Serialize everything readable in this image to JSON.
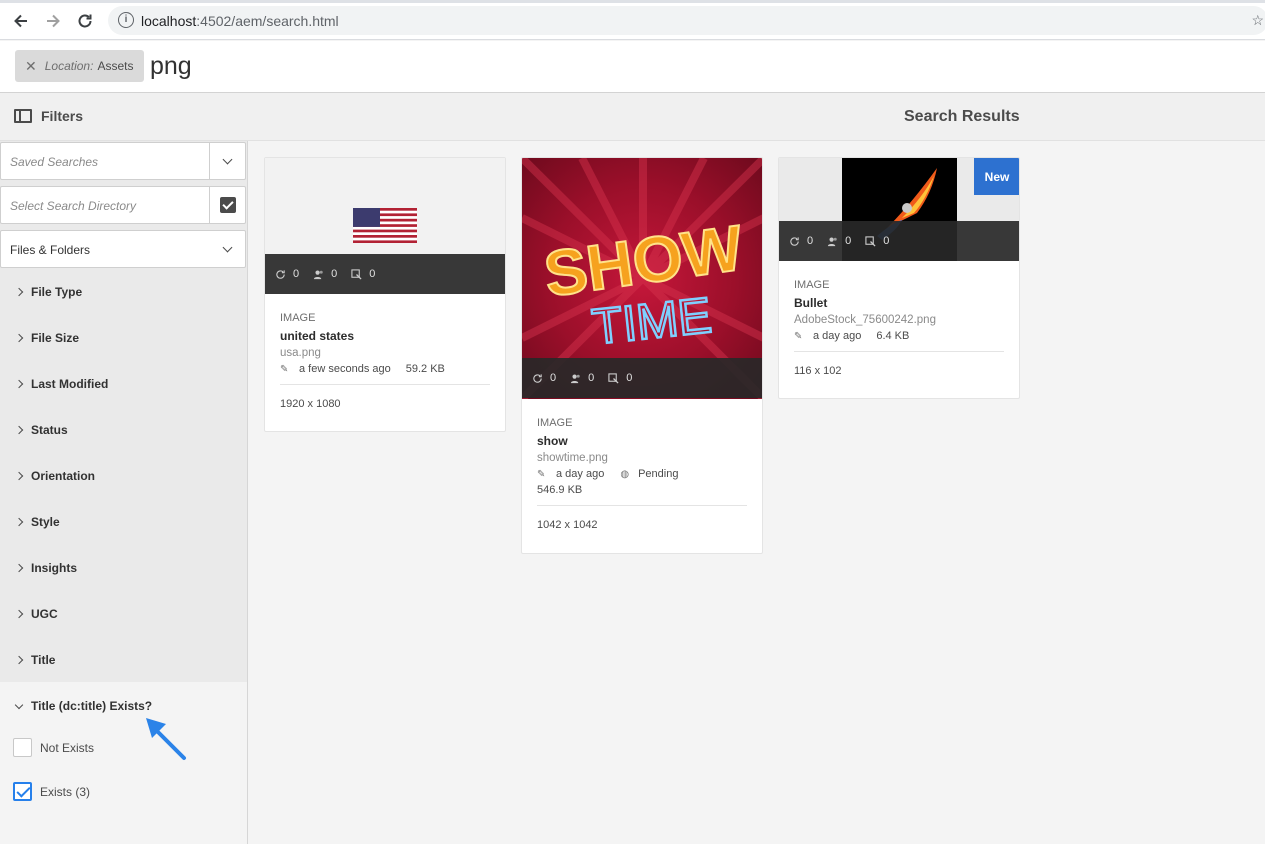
{
  "browser": {
    "url_host": "localhost",
    "url_rest": ":4502/aem/search.html"
  },
  "search": {
    "location_key": "Location:",
    "location_value": "Assets",
    "query": "png"
  },
  "header": {
    "filters_label": "Filters",
    "results_label": "Search Results"
  },
  "rail": {
    "saved_searches_placeholder": "Saved Searches",
    "directory_placeholder": "Select Search Directory",
    "scope_value": "Files & Folders",
    "facets": [
      "File Type",
      "File Size",
      "Last Modified",
      "Status",
      "Orientation",
      "Style",
      "Insights",
      "UGC",
      "Title"
    ],
    "expanded_facet": "Title (dc:title) Exists?",
    "options": [
      {
        "label": "Not Exists",
        "checked": false
      },
      {
        "label": "Exists (3)",
        "checked": true
      }
    ]
  },
  "cards": [
    {
      "type": "IMAGE",
      "title": "united states",
      "file": "usa.png",
      "modified": "a few seconds ago",
      "size": "59.2 KB",
      "dimensions": "1920 x 1080",
      "counts": [
        "0",
        "0",
        "0"
      ]
    },
    {
      "type": "IMAGE",
      "title": "show",
      "file": "showtime.png",
      "modified": "a day ago",
      "status": "Pending",
      "size": "546.9 KB",
      "dimensions": "1042 x 1042",
      "counts": [
        "0",
        "0",
        "0"
      ],
      "image_text_1": "SHOW",
      "image_text_2": "TIME"
    },
    {
      "type": "IMAGE",
      "title": "Bullet",
      "file": "AdobeStock_75600242.png",
      "modified": "a day ago",
      "size": "6.4 KB",
      "dimensions": "116 x 102",
      "counts": [
        "0",
        "0",
        "0"
      ],
      "badge": "New"
    }
  ],
  "colors": {
    "accent": "#2680eb",
    "badge": "#2d71d0",
    "annotation_arrow": "#2b83e8"
  }
}
